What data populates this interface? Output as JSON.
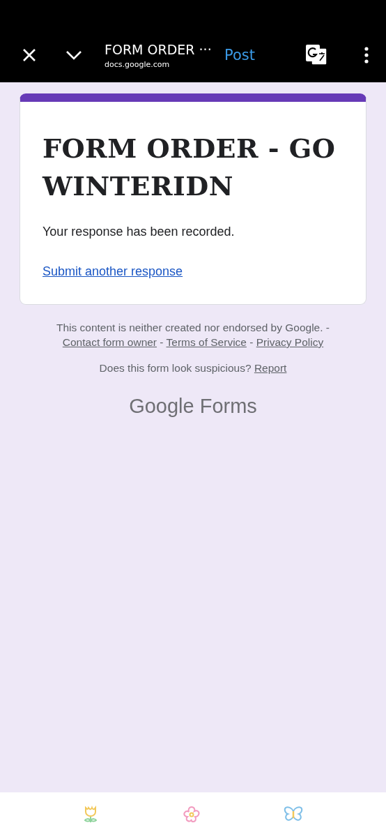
{
  "header": {
    "title": "FORM ORDER ···",
    "url": "docs.google.com",
    "post": "Post"
  },
  "card": {
    "title": "FORM ORDER - GO WINTERIDN",
    "message": "Your response has been recorded.",
    "link": "Submit another response"
  },
  "footer": {
    "disclaimer": "This content is neither created nor endorsed by Google. -",
    "links": [
      "Contact form owner",
      "Terms of Service",
      "Privacy Policy"
    ],
    "separator": "-",
    "question": "Does this form look suspicious?",
    "report": "Report",
    "logo_google": "Google",
    "logo_forms": "Forms"
  }
}
